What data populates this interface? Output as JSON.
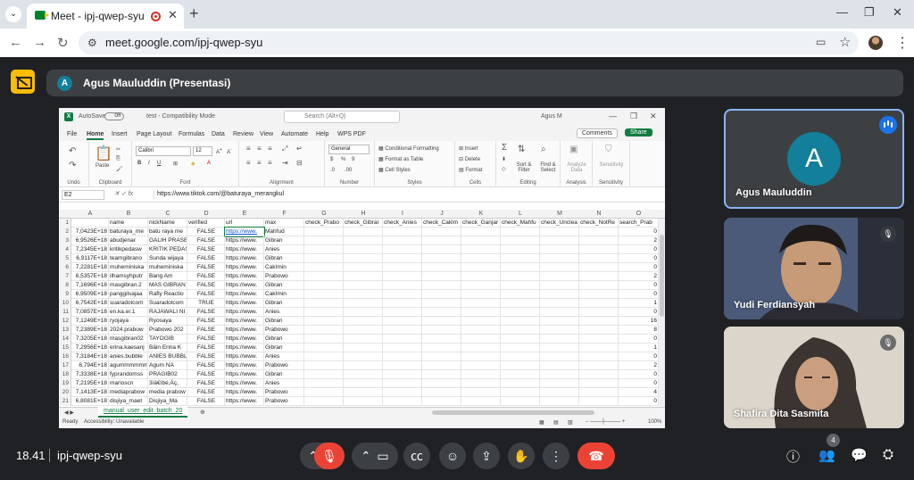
{
  "browser": {
    "tab_title": "Meet - ipj-qwep-syu",
    "url": "meet.google.com/ipj-qwep-syu"
  },
  "meet": {
    "presenter_initial": "A",
    "presenter_label": "Agus Mauluddin (Presentasi)",
    "time": "18.41",
    "meeting_code": "ipj-qwep-syu",
    "participants_count": "4",
    "participants": [
      {
        "name": "Agus Mauluddin",
        "initial": "A"
      },
      {
        "name": "Yudi Ferdiansyah"
      },
      {
        "name": "Shafira Dita Sasmita"
      }
    ]
  },
  "excel": {
    "autosave": "AutoSave",
    "autosave_state": "Off",
    "filename": "test - Compatibility Mode",
    "search_placeholder": "Search (Alt+Q)",
    "user": "Agus M",
    "menu": [
      "File",
      "Home",
      "Insert",
      "Page Layout",
      "Formulas",
      "Data",
      "Review",
      "View",
      "Automate",
      "Help",
      "WPS PDF"
    ],
    "comments": "Comments",
    "share": "Share",
    "ribbon": {
      "undo": "Undo",
      "paste": "Paste",
      "clipboard": "Clipboard",
      "font_name": "Calibri",
      "font_size": "12",
      "font": "Font",
      "alignment": "Alignment",
      "number_format": "General",
      "number": "Number",
      "cond_format": "Conditional Formatting",
      "format_table": "Format as Table",
      "cell_styles": "Cell Styles",
      "styles": "Styles",
      "insert": "Insert",
      "delete": "Delete",
      "format": "Format",
      "cells": "Cells",
      "sort_filter": "Sort & Filter",
      "find_select": "Find & Select",
      "editing": "Editing",
      "analyze_data": "Analyze Data",
      "analysis": "Analysis",
      "sensitivity": "Sensitivity"
    },
    "namebox": "E2",
    "formula": "https://www.tiktok.com/@baturaya_merangkul",
    "columns": [
      "A",
      "B",
      "C",
      "D",
      "E",
      "F",
      "G",
      "H",
      "I",
      "J",
      "K",
      "L",
      "M",
      "N",
      "O"
    ],
    "headers": [
      "",
      "name",
      "nickName",
      "verified",
      "url",
      "max",
      "check_Prabo",
      "check_Gibrar",
      "check_Anies",
      "check_Caklm",
      "check_Ganjar",
      "check_Mahfu",
      "check_Unclea",
      "check_NotRe",
      "search_Prab"
    ],
    "rows": [
      [
        "7,0423E+18",
        "baturaya_me",
        "batu raya me",
        "FALSE",
        "https://www.",
        "Mahfud",
        "0"
      ],
      [
        "6,9526E+18",
        "abudjenar",
        "GALIH PRASE",
        "FALSE",
        "https://www.",
        "Gibran",
        "2"
      ],
      [
        "7,2345E+18",
        "kritikpedasw",
        "KRITIK PEDAS",
        "FALSE",
        "https://www.",
        "Anies",
        "0"
      ],
      [
        "6,9117E+18",
        "teamgibrano",
        "Sunda wijaya",
        "FALSE",
        "https://www.",
        "Gibran",
        "0"
      ],
      [
        "7,2281E+18",
        "muheminiska",
        "muheminiska",
        "FALSE",
        "https://www.",
        "CakImin",
        "0"
      ],
      [
        "6,5357E+18",
        "ilhamsyhputr",
        "Bang Am",
        "FALSE",
        "https://www.",
        "Prabowo",
        "2"
      ],
      [
        "7,1696E+18",
        "masgibran.2",
        "MAS GIBRAN",
        "FALSE",
        "https://www.",
        "Gibran",
        "0"
      ],
      [
        "6,9509E+18",
        "panggilsajaa",
        "Rafly Reactio",
        "FALSE",
        "https://www.",
        "CakImin",
        "0"
      ],
      [
        "6,7542E+18",
        "suaradotcom",
        "Suaradotcom",
        "TRUE",
        "https://www.",
        "Gibran",
        "1"
      ],
      [
        "7,0857E+18",
        "en.ka.er.1",
        "RAJAWALI NI",
        "FALSE",
        "https://www.",
        "Anies",
        "0"
      ],
      [
        "7,1249E+18",
        "ryojaya",
        "Ryosaya",
        "FALSE",
        "https://www.",
        "Gibran",
        "16"
      ],
      [
        "7,2389E+18",
        "2024.prabow",
        "Prabowo 202",
        "FALSE",
        "https://www.",
        "Prabowo",
        "8"
      ],
      [
        "7,3205E+18",
        "masgibran02",
        "TAYOGIB",
        "FALSE",
        "https://www.",
        "Gibran",
        "0"
      ],
      [
        "7,2956E+18",
        "erina.kaesanj",
        "Bäin Erina K",
        "FALSE",
        "https://www.",
        "Gibran",
        "1"
      ],
      [
        "7,3184E+18",
        "anies.bubble",
        "ANIES BUBBL",
        "FALSE",
        "https://www.",
        "Anies",
        "0"
      ],
      [
        "6,794E+18",
        "agummmmmm",
        "Agum NA",
        "FALSE",
        "https://www.",
        "Prabowo",
        "2"
      ],
      [
        "7,3338E+18",
        "fyprandomss",
        "PRAGIB02",
        "FALSE",
        "https://www.",
        "Gibran",
        "0"
      ],
      [
        "7,2195E+18",
        "marioscn",
        "3ìä€ìbé,Äç,",
        "FALSE",
        "https://www.",
        "Anies",
        "0"
      ],
      [
        "7,1413E+18",
        "mediaprabow",
        "media prabow",
        "FALSE",
        "https://www.",
        "Prabowo",
        "4"
      ],
      [
        "6,8081E+18",
        "disjiya_maet",
        "Disjiya_Ma",
        "FALSE",
        "https://www.",
        "Prabowo",
        "0"
      ]
    ],
    "sheet_tab": "manual_user_edit_batch_20",
    "status_ready": "Ready",
    "status_access": "Accessibility: Unavailable",
    "zoom": "100%"
  }
}
